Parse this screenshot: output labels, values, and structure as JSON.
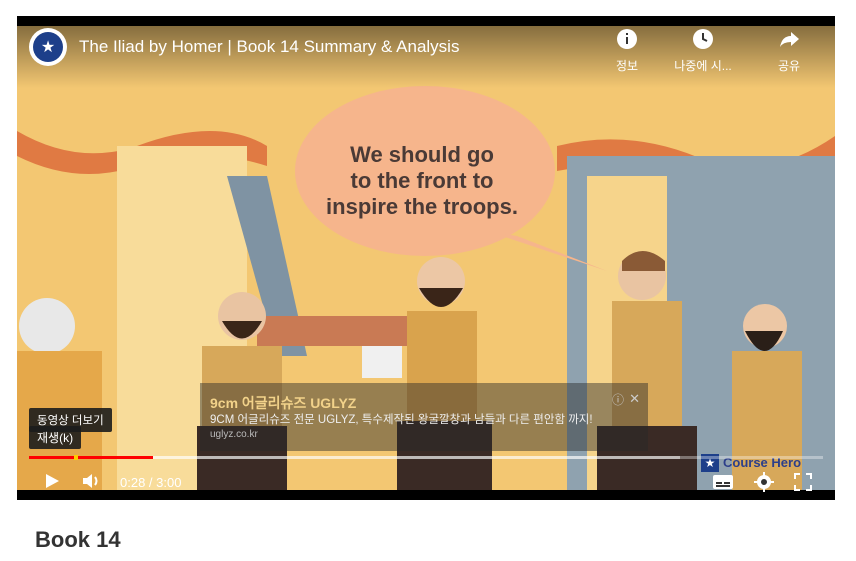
{
  "video": {
    "title": "The Iliad by Homer | Book 14 Summary & Analysis",
    "speech_bubble": [
      "We should go",
      "to the front to",
      "inspire the troops."
    ],
    "top_actions": [
      {
        "icon": "info-icon",
        "label": "정보"
      },
      {
        "icon": "clock-icon",
        "label": "나중에 시..."
      },
      {
        "icon": "share-icon",
        "label": "공유"
      }
    ]
  },
  "ad": {
    "title": "9cm 어글리슈즈 UGLYZ",
    "body": "9CM 어글리슈즈 전문 UGLYZ, 특수제작된 왕굴깔창과 남들과 다른 편안함 까지!",
    "url": "uglyz.co.kr",
    "info_glyph": "ⓘ",
    "close_glyph": "✕"
  },
  "tooltip": {
    "more_videos": "동영상 더보기",
    "play_hint": "재생(k)"
  },
  "player": {
    "current_time": "0:28",
    "duration": "3:00",
    "played_fraction": 0.156,
    "loaded_fraction": 0.82,
    "watermark": "Course Hero"
  },
  "page": {
    "heading": "Book 14"
  },
  "colors": {
    "progress_played": "#ff0000",
    "background_yellow": "#f4c979",
    "curtain_orange": "#e07a43"
  }
}
